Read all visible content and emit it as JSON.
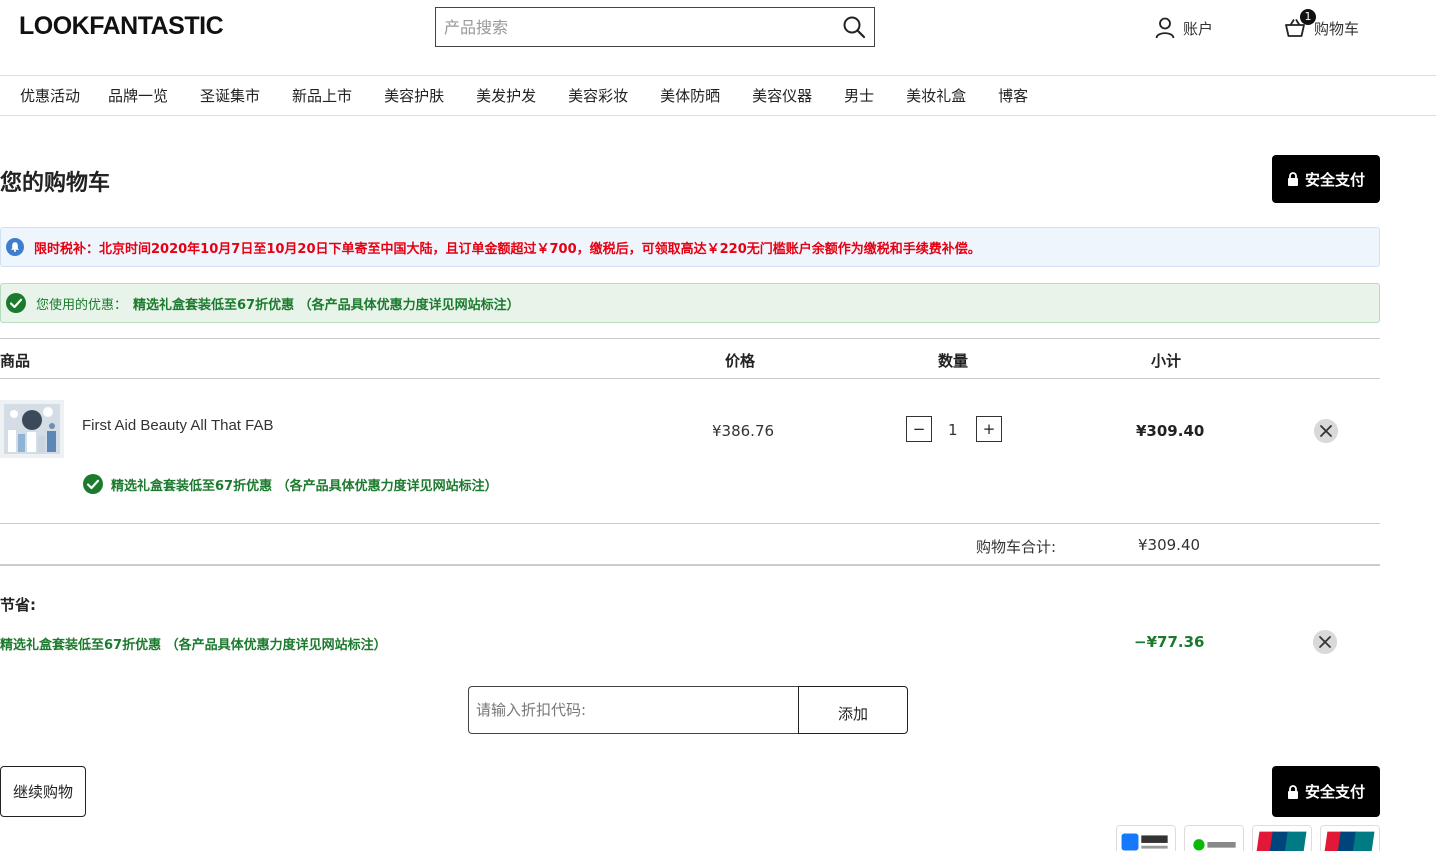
{
  "header": {
    "logo": "LOOKFANTASTIC",
    "search_placeholder": "产品搜索",
    "account_label": "账户",
    "cart_label": "购物车",
    "cart_count": "1"
  },
  "nav": [
    "优惠活动",
    "品牌一览",
    "圣诞集市",
    "新品上市",
    "美容护肤",
    "美发护发",
    "美容彩妆",
    "美体防晒",
    "美容仪器",
    "男士",
    "美妆礼盒",
    "博客"
  ],
  "page": {
    "title": "您的购物车",
    "secure_checkout": "安全支付"
  },
  "notices": {
    "info": "限时税补：北京时间2020年10月7日至10月20日下单寄至中国大陆，且订单金额超过￥700，缴税后，可领取高达￥220无门槛账户余额作为缴税和手续费补偿。",
    "promo_label": "您使用的优惠：",
    "promo_value": "精选礼盒套装低至67折优惠 （各产品具体优惠力度详见网站标注）"
  },
  "table": {
    "headers": {
      "product": "商品",
      "price": "价格",
      "quantity": "数量",
      "subtotal": "小计"
    },
    "items": [
      {
        "name": "First Aid Beauty All That FAB",
        "price": "¥386.76",
        "quantity": "1",
        "subtotal": "¥309.40",
        "promo": "精选礼盒套装低至67折优惠 （各产品具体优惠力度详见网站标注）"
      }
    ],
    "minus_label": "−",
    "plus_label": "+"
  },
  "totals": {
    "cart_total_label": "购物车合计:",
    "cart_total_value": "¥309.40",
    "savings_label": "节省:",
    "savings_line": "精选礼盒套装低至67折优惠 （各产品具体优惠力度详见网站标注）",
    "savings_value": "−¥77.36"
  },
  "discount": {
    "placeholder": "请输入折扣代码:",
    "add_label": "添加"
  },
  "actions": {
    "continue_shopping": "继续购物"
  },
  "colors": {
    "promo_green": "#1c7a2e",
    "alert_red": "#e60012",
    "info_blue": "#3d7fcc"
  }
}
